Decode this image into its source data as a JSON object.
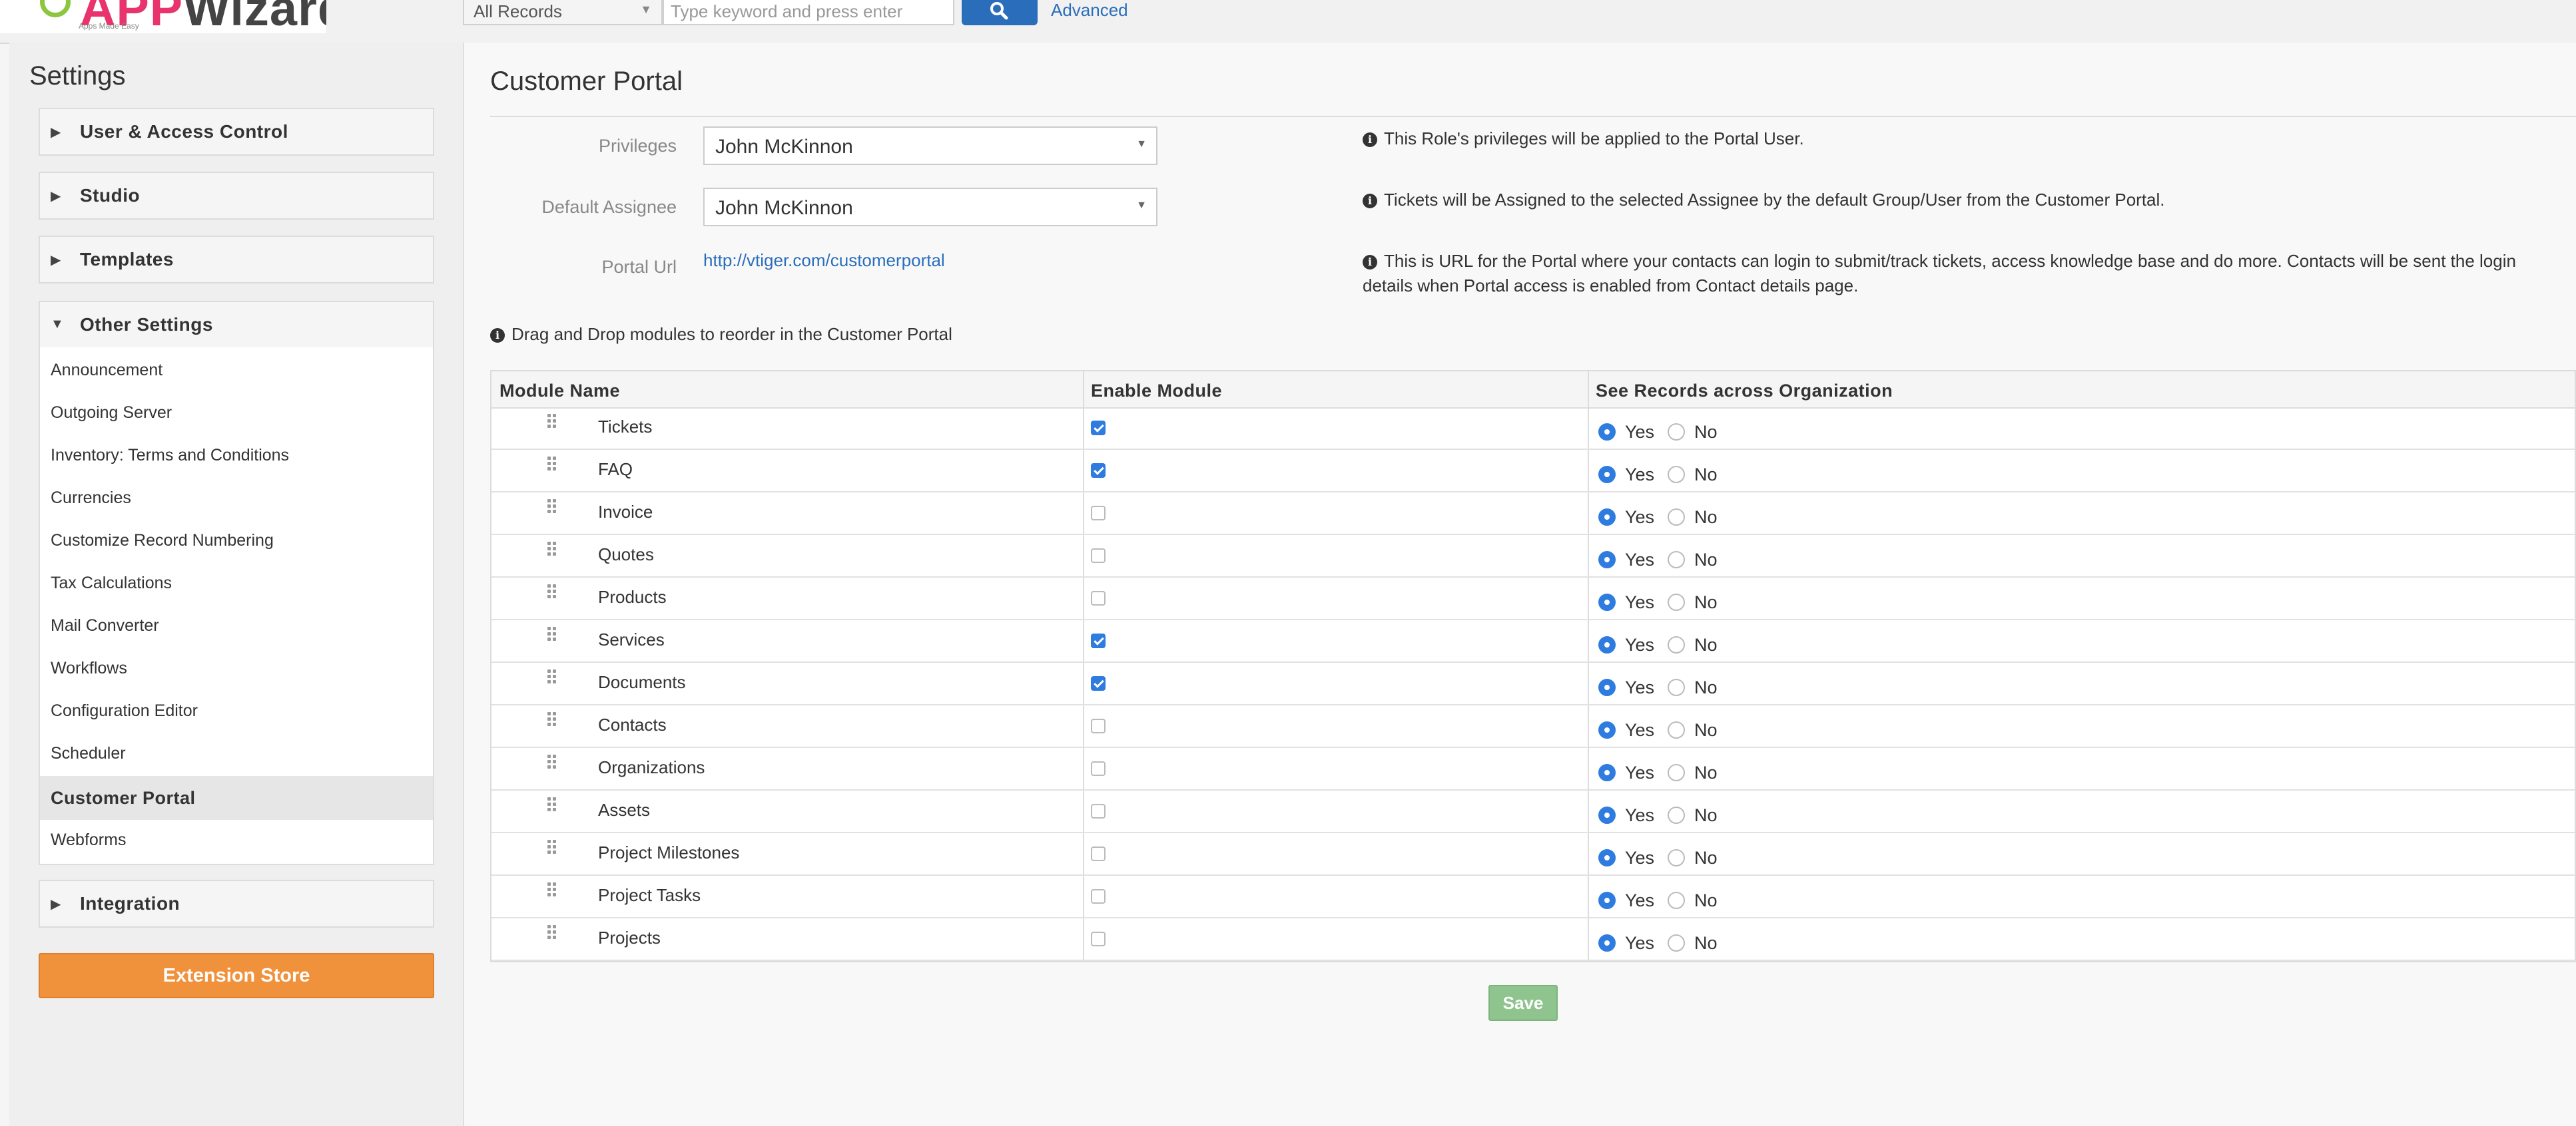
{
  "header": {
    "logo_text_a": "APP",
    "logo_text_b": "Wizards",
    "logo_tagline": "Apps Made Easy",
    "record_filter": "All Records",
    "search_placeholder": "Type keyword and press enter",
    "advanced_label": "Advanced"
  },
  "sidebar": {
    "title": "Settings",
    "sections": [
      {
        "label": "User & Access Control",
        "expanded": false
      },
      {
        "label": "Studio",
        "expanded": false
      },
      {
        "label": "Templates",
        "expanded": false
      },
      {
        "label": "Other Settings",
        "expanded": true
      },
      {
        "label": "Integration",
        "expanded": false
      }
    ],
    "other_items": [
      "Announcement",
      "Outgoing Server",
      "Inventory: Terms and Conditions",
      "Currencies",
      "Customize Record Numbering",
      "Tax Calculations",
      "Mail Converter",
      "Workflows",
      "Configuration Editor",
      "Scheduler",
      "Customer Portal",
      "Webforms"
    ],
    "active_item": "Customer Portal",
    "extension_store_label": "Extension Store"
  },
  "main": {
    "title": "Customer Portal",
    "privileges_label": "Privileges",
    "privileges_value": "John McKinnon",
    "privileges_info": "This Role's privileges will be applied to the Portal User.",
    "assignee_label": "Default Assignee",
    "assignee_value": "John McKinnon",
    "assignee_info": "Tickets will be Assigned to the selected Assignee by the default Group/User from the Customer Portal.",
    "url_label": "Portal Url",
    "url_value": "http://vtiger.com/customerportal",
    "url_info_line1": "This is URL for the Portal where your contacts can login to submit/track tickets, access knowledge base and do more. Contacts will be sent the login",
    "url_info_line2": "details when Portal access is enabled from Contact details page.",
    "drag_info": "Drag and Drop modules to reorder in the Customer Portal",
    "table": {
      "headers": [
        "Module Name",
        "Enable Module",
        "See Records across Organization"
      ],
      "yes_label": "Yes",
      "no_label": "No",
      "rows": [
        {
          "name": "Tickets",
          "enabled": true,
          "see_all": "yes"
        },
        {
          "name": "FAQ",
          "enabled": true,
          "see_all": "yes"
        },
        {
          "name": "Invoice",
          "enabled": false,
          "see_all": "yes"
        },
        {
          "name": "Quotes",
          "enabled": false,
          "see_all": "yes"
        },
        {
          "name": "Products",
          "enabled": false,
          "see_all": "yes"
        },
        {
          "name": "Services",
          "enabled": true,
          "see_all": "yes"
        },
        {
          "name": "Documents",
          "enabled": true,
          "see_all": "yes"
        },
        {
          "name": "Contacts",
          "enabled": false,
          "see_all": "yes"
        },
        {
          "name": "Organizations",
          "enabled": false,
          "see_all": "yes"
        },
        {
          "name": "Assets",
          "enabled": false,
          "see_all": "yes"
        },
        {
          "name": "Project Milestones",
          "enabled": false,
          "see_all": "yes"
        },
        {
          "name": "Project Tasks",
          "enabled": false,
          "see_all": "yes"
        },
        {
          "name": "Projects",
          "enabled": false,
          "see_all": "yes"
        }
      ]
    },
    "save_label": "Save"
  },
  "colors": {
    "accent": "#2a6ebb",
    "extension_button": "#f0913b",
    "save_button": "#8fc48f",
    "checkbox_on": "#2f7ce0"
  }
}
